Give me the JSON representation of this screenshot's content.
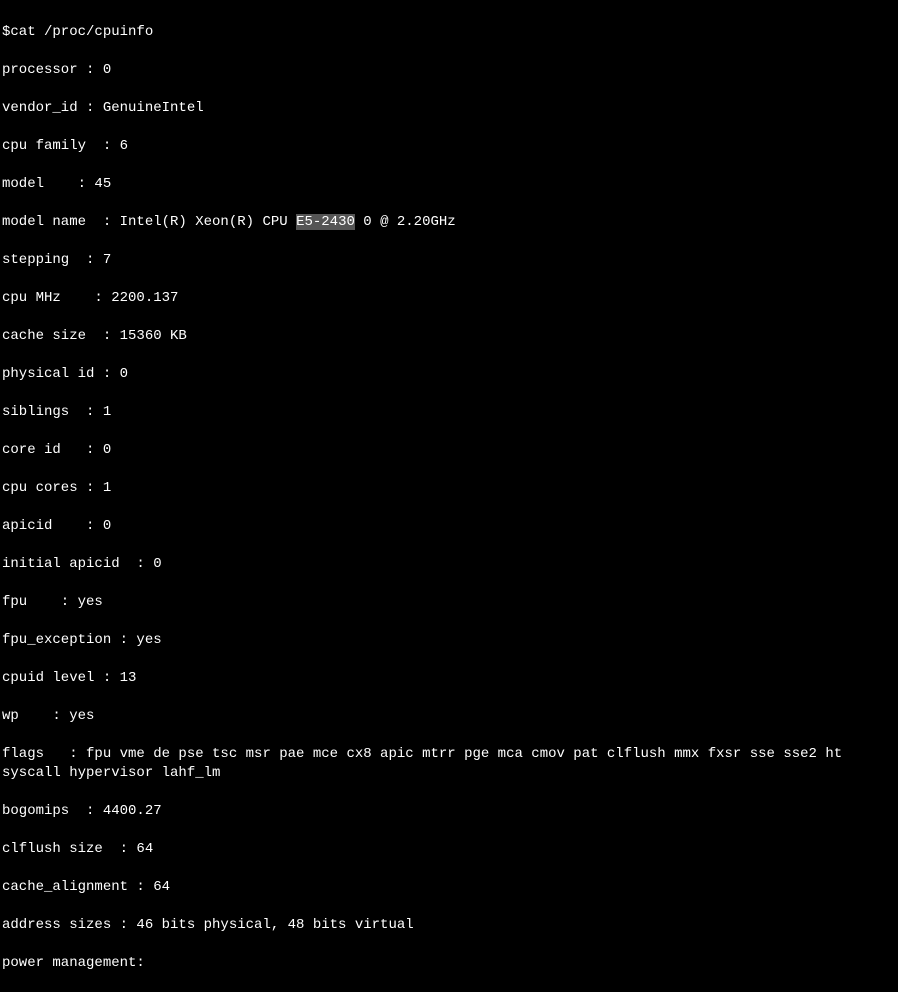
{
  "command": "$cat /proc/cpuinfo",
  "lines": {
    "processor": "processor : 0",
    "vendor_id": "vendor_id : GenuineIntel",
    "cpu_family": "cpu family  : 6",
    "model": "model    : 45",
    "model_name_pre": "model name  : Intel(R) Xeon(R) CPU ",
    "model_name_hl": "E5-2430",
    "model_name_post": " 0 @ 2.20GHz",
    "stepping": "stepping  : 7",
    "cpu_mhz": "cpu MHz    : 2200.137",
    "cache_size": "cache size  : 15360 KB",
    "physical_id": "physical id : 0",
    "siblings": "siblings  : 1",
    "core_id": "core id   : 0",
    "cpu_cores": "cpu cores : 1",
    "apicid": "apicid    : 0",
    "initial_apicid": "initial apicid  : 0",
    "fpu": "fpu    : yes",
    "fpu_exception": "fpu_exception : yes",
    "cpuid_level": "cpuid level : 13",
    "wp": "wp    : yes",
    "flags": "flags   : fpu vme de pse tsc msr pae mce cx8 apic mtrr pge mca cmov pat clflush mmx fxsr sse sse2 ht syscall hypervisor lahf_lm",
    "bogomips": "bogomips  : 4400.27",
    "clflush_size": "clflush size  : 64",
    "cache_alignment": "cache_alignment : 64",
    "address_sizes": "address sizes : 46 bits physical, 48 bits virtual",
    "power_management": "power management:"
  }
}
